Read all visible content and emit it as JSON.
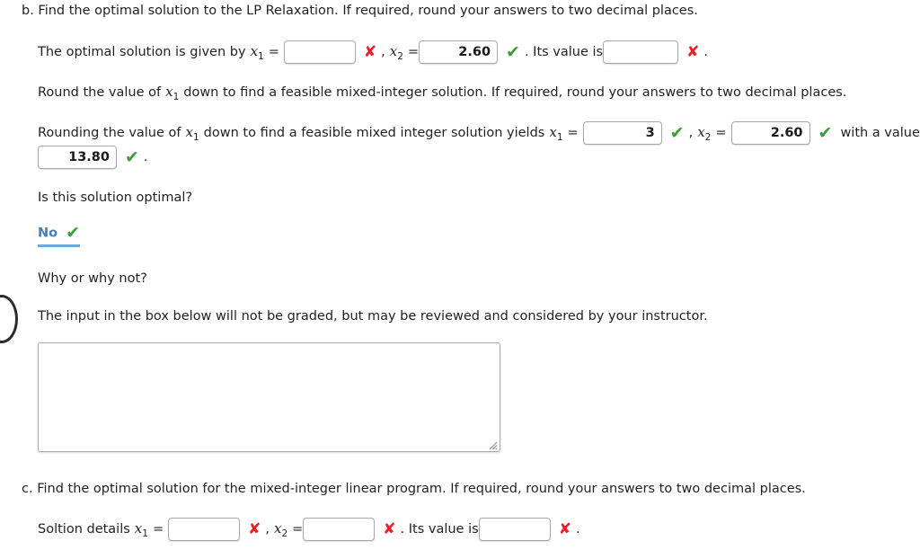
{
  "part_b": {
    "prompt": "b. Find the optimal solution to the LP Relaxation. If required, round your answers to two decimal places.",
    "answer_line": {
      "lead": "The optimal solution is given by",
      "x1_label": "x",
      "x1_sub": "1",
      "equals": "=",
      "x1_value": "",
      "x1_mark": "✘",
      "comma": ",",
      "x2_label": "x",
      "x2_sub": "2",
      "x2_value": "2.60",
      "x2_mark": "✔",
      "mid": ". Its value is",
      "value_value": "",
      "value_mark": "✘",
      "period": "."
    }
  },
  "rounding": {
    "prompt": "Round the value of x₁ down to find a feasible mixed-integer solution. If required, round your answers to two decimal places.",
    "prompt_pre": "Round the value of",
    "prompt_post": "down to find a feasible mixed-integer solution. If required, round your answers to two decimal places.",
    "answer_line": {
      "lead_pre": "Rounding the value of",
      "lead_post": "down to find a feasible mixed integer solution yields",
      "x1_label": "x",
      "x1_sub": "1",
      "equals": "=",
      "x1_value": "3",
      "x1_mark": "✔",
      "comma": ",",
      "x2_label": "x",
      "x2_sub": "2",
      "x2_value": "2.60",
      "x2_mark": "✔",
      "tail": "with a value of",
      "value_value": "13.80",
      "value_mark": "✔",
      "period": "."
    }
  },
  "optimal_question": {
    "question": "Is this solution optimal?",
    "selected": "No",
    "mark": "✔"
  },
  "why": {
    "question": "Why or why not?",
    "note": "The input in the box below will not be graded, but may be reviewed and considered by your instructor.",
    "essay_value": ""
  },
  "part_c": {
    "prompt": "c. Find the optimal solution for the mixed-integer linear program. If required, round your answers to two decimal places.",
    "answer_line": {
      "lead": "Soltion details",
      "x1_label": "x",
      "x1_sub": "1",
      "equals": "=",
      "x1_value": "",
      "x1_mark": "✘",
      "comma": ",",
      "x2_label": "x",
      "x2_sub": "2",
      "x2_value": "",
      "x2_mark": "✘",
      "mid": ". Its value is",
      "value_value": "",
      "value_mark": "✘",
      "period": "."
    }
  },
  "colors": {
    "wrong": "#ee1c25",
    "right": "#3aa03a",
    "select_blue": "#4a7fb5",
    "underline_blue": "#6fa8dc",
    "box_border": "#a9a9a9",
    "text": "#231f20"
  }
}
